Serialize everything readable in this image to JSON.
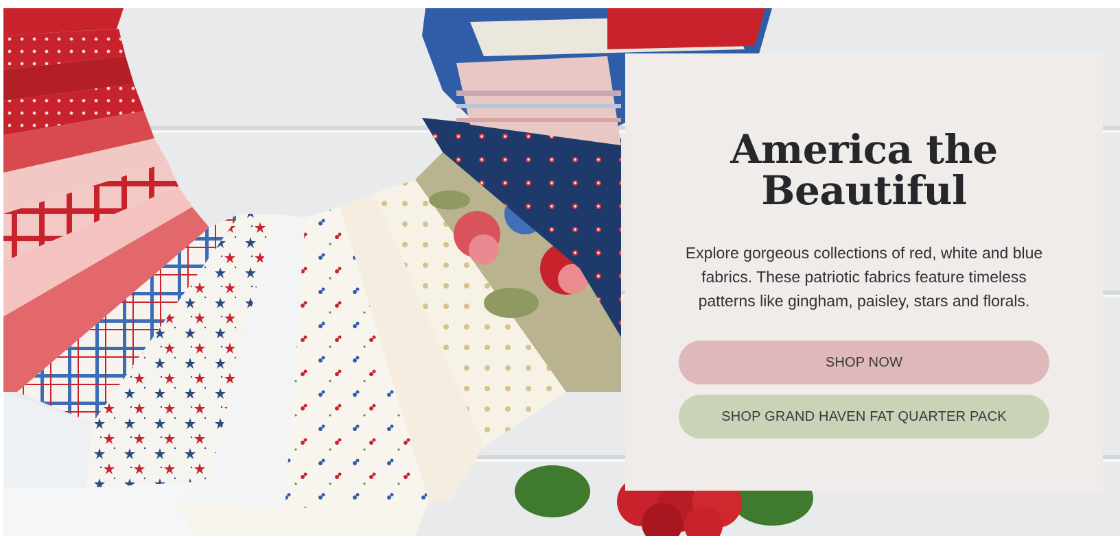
{
  "hero": {
    "title": "America the Beautiful",
    "description": "Explore gorgeous collections of red, white and blue fabrics. These patriotic fabrics feature timeless patterns like gingham, paisley, stars and florals.",
    "buttons": {
      "shop_now": "SHOP NOW",
      "shop_pack": "SHOP GRAND HAVEN FAT QUARTER PACK"
    },
    "colors": {
      "panel_bg": "#f0ece9",
      "title": "#25272b",
      "shop_now_bg": "#dfb8bb",
      "shop_pack_bg": "#c9d3b8",
      "fabric_red": "#c8232c",
      "fabric_navy": "#1e3a6b",
      "fabric_cream": "#f5f0e4"
    }
  }
}
